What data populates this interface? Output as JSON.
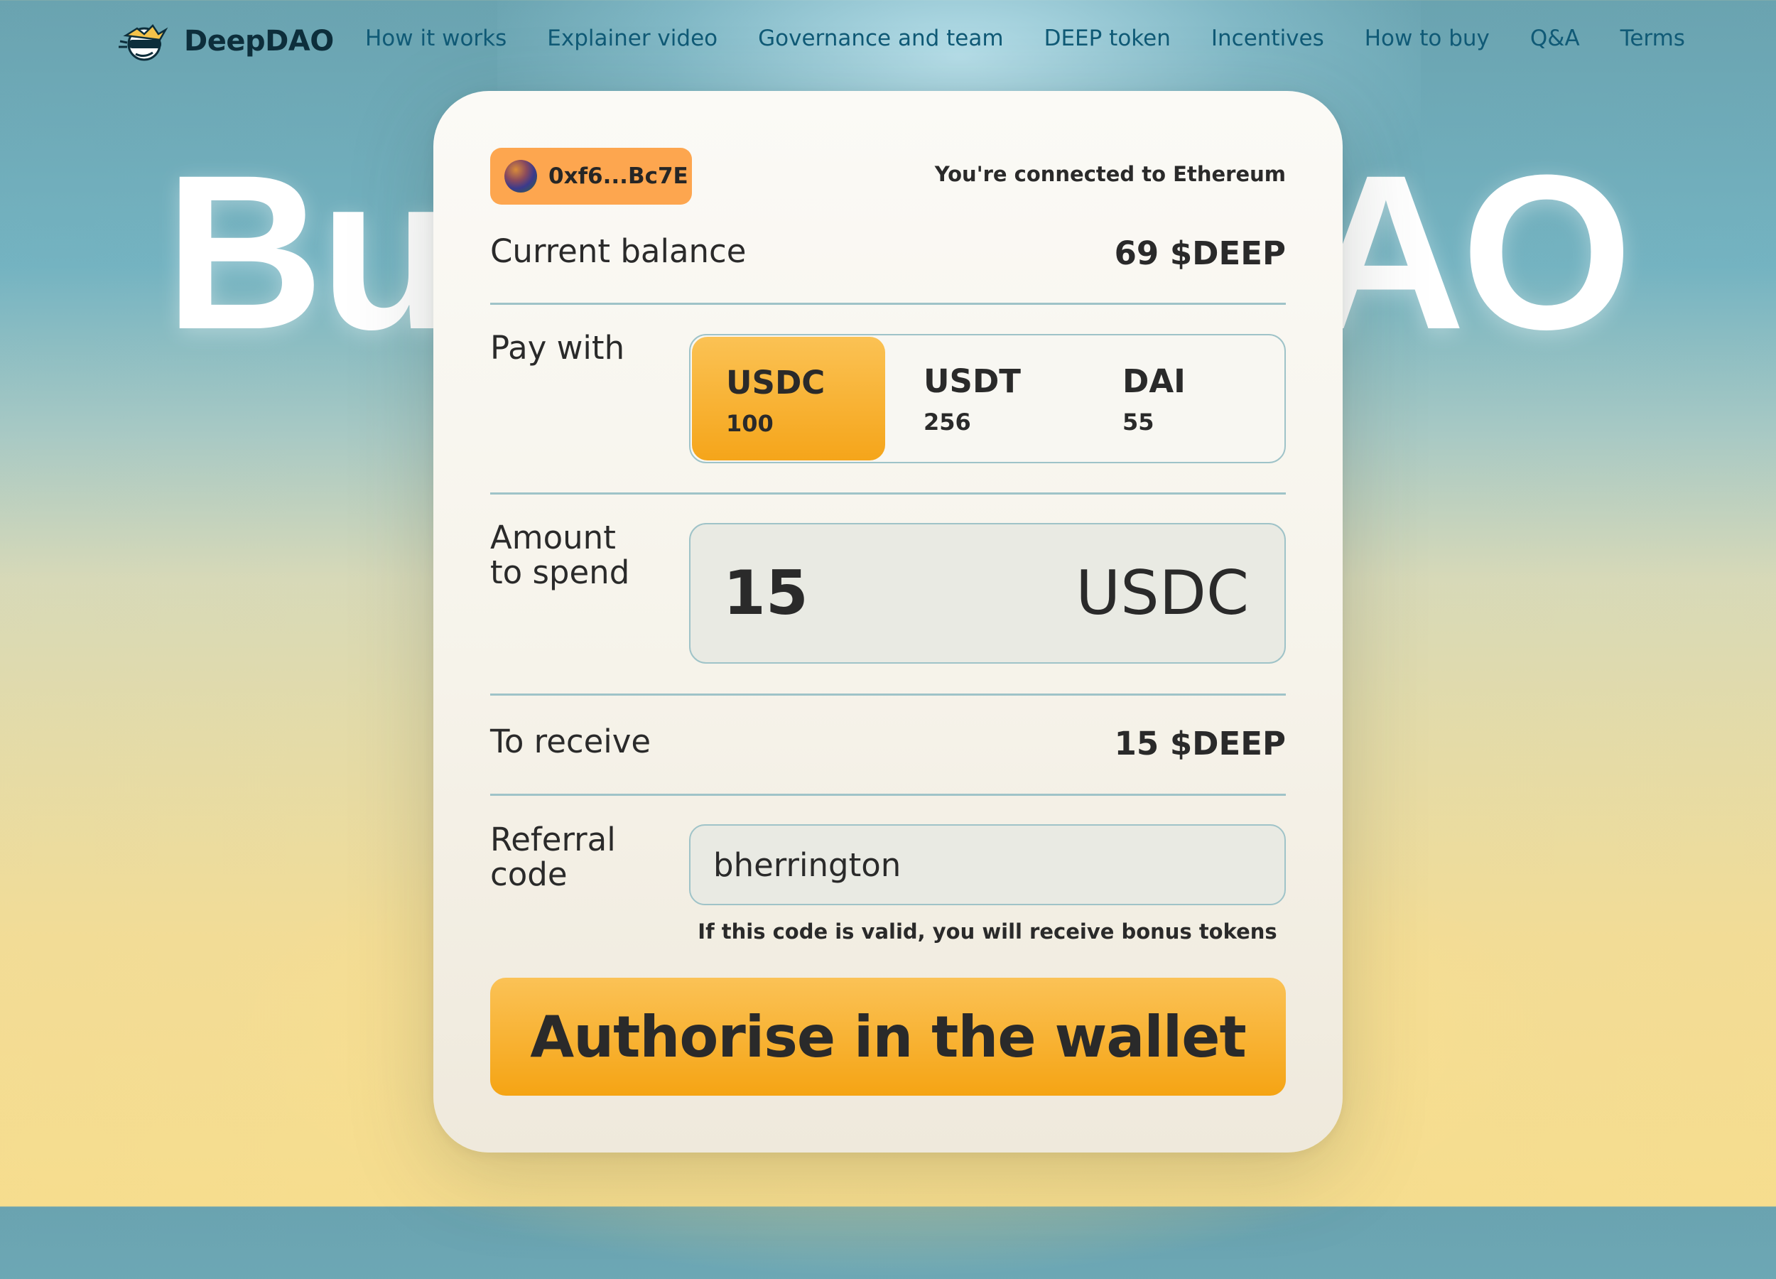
{
  "nav": {
    "brand": "DeepDAO",
    "links": [
      "How it works",
      "Explainer video",
      "Governance and team",
      "DEEP token",
      "Incentives",
      "How to buy",
      "Q&A",
      "Terms"
    ]
  },
  "hero": {
    "title_left": "Bu",
    "title_right": "AO"
  },
  "card": {
    "wallet_address": "0xf6...Bc7E",
    "connection_status": "You're connected to Ethereum",
    "balance_label": "Current balance",
    "balance_value": "69 $DEEP",
    "pay_with_label": "Pay with",
    "tokens": [
      {
        "name": "USDC",
        "balance": "100",
        "selected": true
      },
      {
        "name": "USDT",
        "balance": "256",
        "selected": false
      },
      {
        "name": "DAI",
        "balance": "55",
        "selected": false
      }
    ],
    "amount_label_line1": "Amount",
    "amount_label_line2": "to spend",
    "amount_value": "15",
    "amount_unit": "USDC",
    "receive_label": "To receive",
    "receive_value": "15 $DEEP",
    "referral_label_line1": "Referral",
    "referral_label_line2": "code",
    "referral_value": "bherrington",
    "referral_hint": "If this code is valid, you will receive bonus tokens",
    "cta_label": "Authorise in the wallet"
  },
  "colors": {
    "accent": "#f5a51a",
    "wallet_chip": "#fda64f",
    "nav_link": "#105a76",
    "divider": "#9fc3c8"
  }
}
